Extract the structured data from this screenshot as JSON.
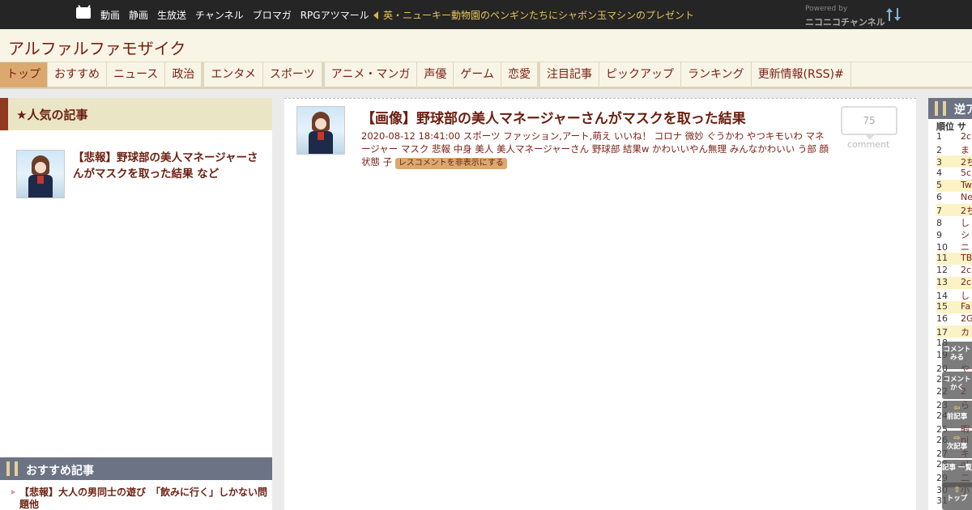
{
  "topbar": {
    "nav": [
      "動画",
      "静画",
      "生放送",
      "チャンネル",
      "ブロマガ",
      "RPGアツマール"
    ],
    "news": "英・ニューキー動物園のペンギンたちにシャボン玉マシンのプレゼント",
    "powered_small": "Powered by",
    "powered_big": "ニコニコチャンネル"
  },
  "site": {
    "title": "アルファルファモザイク"
  },
  "navtabs": [
    "トップ",
    "おすすめ",
    "ニュース",
    "政治",
    "エンタメ",
    "スポーツ",
    "アニメ・マンガ",
    "声優",
    "ゲーム",
    "恋愛",
    "注目記事",
    "ピックアップ",
    "ランキング",
    "更新情報(RSS)#"
  ],
  "left": {
    "popular_heading": "★人気の記事",
    "popular_item": "【悲報】野球部の美人マネージャーさんがマスクを取った結果 など",
    "recommend_heading": "おすすめ記事",
    "recommend_item": "【悲報】大人の男同士の遊び　「飲みに行く」しかない問題他"
  },
  "article": {
    "title": "【画像】野球部の美人マネージャーさんがマスクを取った結果",
    "meta": "2020-08-12 18:41:00 スポーツ ファッション,アート,萌え いいね！ コロナ 微妙 ぐうかわ やつキモいわ マネージャー マスク 悲報 中身 美人 美人マネージャーさん 野球部 結果w かわいいやん無理 みんなかわいい う部 顔 状態 子",
    "hide_button": "レスコメントを非表示にする",
    "comment_count": "75",
    "comment_label": "comment"
  },
  "right": {
    "heading": "逆ア",
    "rank_header": "順位 サ",
    "ranks": [
      {
        "n": "1",
        "s": "2c"
      },
      {
        "n": "2",
        "s": "ま"
      },
      {
        "n": "3",
        "s": "2ち"
      },
      {
        "n": "4",
        "s": "5c"
      },
      {
        "n": "5",
        "s": "Tw"
      },
      {
        "n": "6",
        "s": "Ne"
      },
      {
        "n": "7",
        "s": "2ち"
      },
      {
        "n": "8",
        "s": "し"
      },
      {
        "n": "9",
        "s": "シ"
      },
      {
        "n": "10",
        "s": "ニ"
      },
      {
        "n": "11",
        "s": "TB"
      },
      {
        "n": "12",
        "s": "2c"
      },
      {
        "n": "13",
        "s": "2c"
      },
      {
        "n": "14",
        "s": "し"
      },
      {
        "n": "15",
        "s": "Fa"
      },
      {
        "n": "16",
        "s": "2G"
      },
      {
        "n": "17",
        "s": "カ"
      },
      {
        "n": "18",
        "s": ""
      },
      {
        "n": "19",
        "s": ""
      },
      {
        "n": "20",
        "s": "や"
      },
      {
        "n": "21",
        "s": ""
      },
      {
        "n": "22",
        "s": "2"
      },
      {
        "n": "23",
        "s": "ら"
      },
      {
        "n": "24",
        "s": ""
      },
      {
        "n": "25",
        "s": "暇"
      },
      {
        "n": "26",
        "s": "ni"
      },
      {
        "n": "27",
        "s": "キ"
      },
      {
        "n": "28",
        "s": "ol"
      },
      {
        "n": "29",
        "s": "二"
      },
      {
        "n": "30",
        "s": "小"
      },
      {
        "n": "31",
        "s": ""
      }
    ]
  },
  "sidebuttons": [
    {
      "icon": "",
      "label": "コメント みる"
    },
    {
      "icon": "",
      "label": "コメント かく"
    },
    {
      "icon": "⇦",
      "label": "前記事"
    },
    {
      "icon": "⇨",
      "label": "次記事"
    },
    {
      "icon": "",
      "label": "記事 一覧"
    },
    {
      "icon": "⇧",
      "label": "トップ"
    }
  ]
}
